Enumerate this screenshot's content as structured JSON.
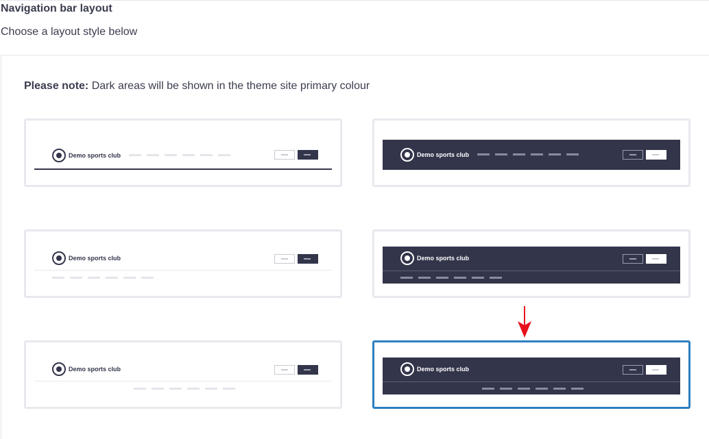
{
  "header": {
    "title": "Navigation bar layout",
    "subtitle": "Choose a layout style below"
  },
  "note": {
    "label": "Please note:",
    "text": " Dark areas will be shown in the theme site primary colour"
  },
  "layouts": [
    {
      "id": "light-inline",
      "logo_text": "Demo sports club",
      "selected": false
    },
    {
      "id": "dark-inline",
      "logo_text": "Demo sports club",
      "selected": false
    },
    {
      "id": "light-stacked-left",
      "logo_text": "Demo sports club",
      "selected": false
    },
    {
      "id": "dark-stacked-left",
      "logo_text": "Demo sports club",
      "selected": false
    },
    {
      "id": "light-stacked-center",
      "logo_text": "Demo sports club",
      "selected": false
    },
    {
      "id": "dark-stacked-center",
      "logo_text": "Demo sports club",
      "selected": true
    }
  ],
  "colors": {
    "primary_dark": "#33354b",
    "selected_border": "#2d7fc1",
    "arrow": "#e8101c"
  },
  "icons": {
    "logo": "club-crest-icon",
    "pointer": "red-down-arrow-icon"
  }
}
